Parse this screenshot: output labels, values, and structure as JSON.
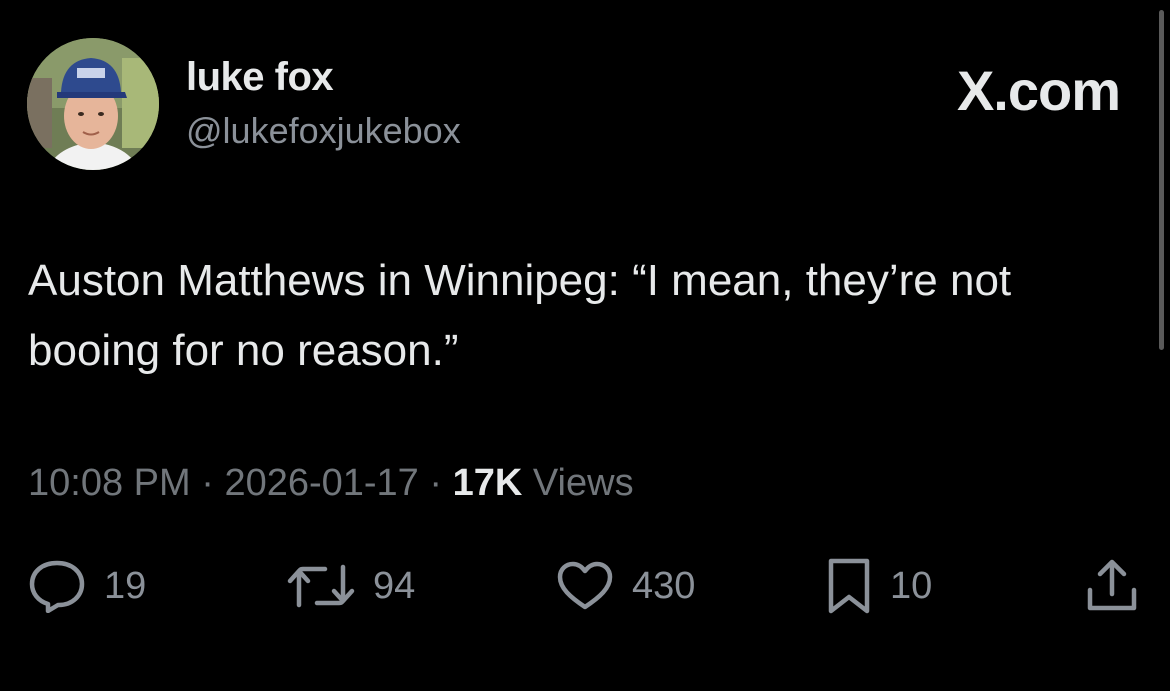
{
  "author": {
    "name": "luke fox",
    "handle": "@lukefoxjukebox"
  },
  "brand": "X.com",
  "tweet": {
    "text": "Auston Matthews in Winnipeg: “I mean, they’re not booing for no reason.”"
  },
  "meta": {
    "time": "10:08 PM",
    "separator": " · ",
    "date": "2026-01-17",
    "views_count": "17K",
    "views_label": " Views"
  },
  "actions": {
    "replies": "19",
    "reposts": "94",
    "likes": "430",
    "bookmarks": "10"
  },
  "icons": {
    "reply": "speech-bubble-icon",
    "repost": "repost-arrows-icon",
    "like": "heart-icon",
    "bookmark": "bookmark-icon",
    "share": "share-icon"
  },
  "colors": {
    "background": "#000000",
    "primary_text": "#e7e9ea",
    "secondary_text": "#71767b"
  }
}
